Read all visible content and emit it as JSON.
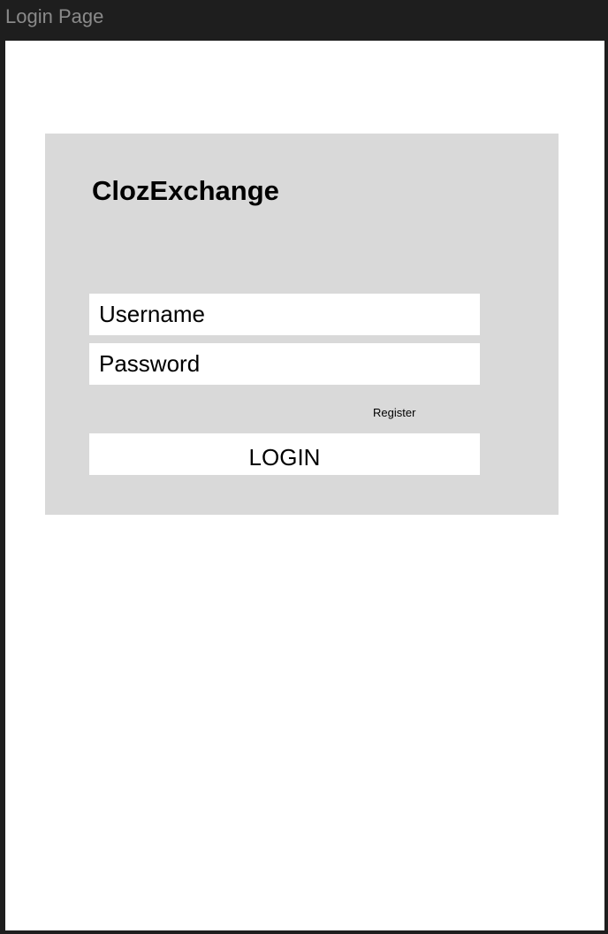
{
  "window": {
    "title": "Login Page"
  },
  "login_card": {
    "brand": "ClozExchange",
    "username": {
      "placeholder": "Username",
      "value": ""
    },
    "password": {
      "placeholder": "Password",
      "value": ""
    },
    "register_label": "Register",
    "login_label": "LOGIN"
  },
  "colors": {
    "window_chrome": "#1e1e1e",
    "title_text": "#8a8a8a",
    "canvas": "#ffffff",
    "card": "#d9d9d9",
    "field": "#ffffff",
    "text": "#000000"
  }
}
